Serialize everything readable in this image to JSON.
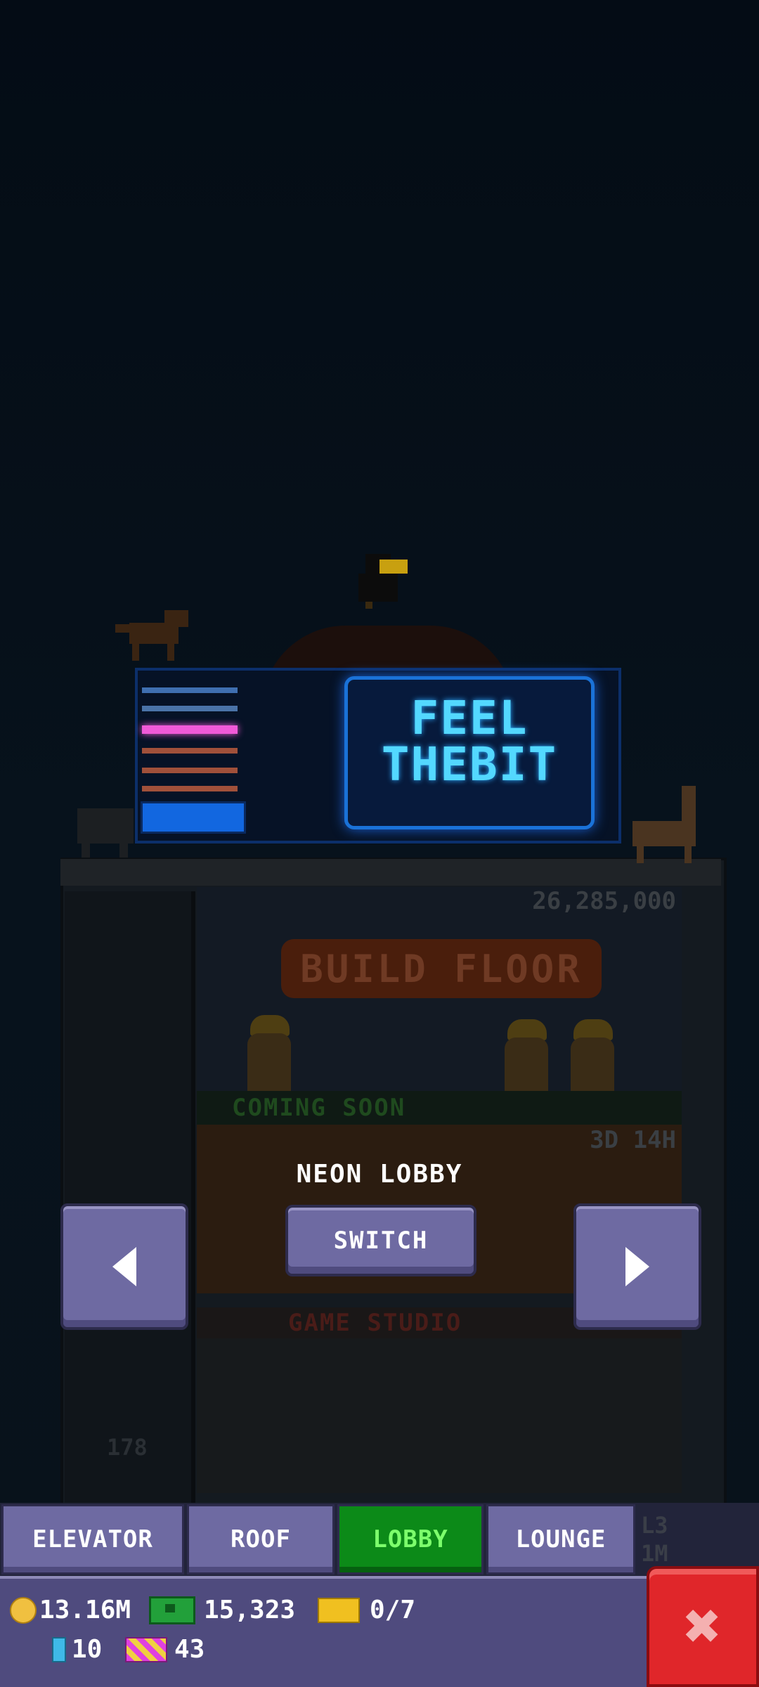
{
  "tower": {
    "build_sign": "BUILD FLOOR",
    "build_price": "26,285,000",
    "coming_soon": "COMING SOON",
    "timer": "3D 14H",
    "studio": "GAME STUDIO",
    "elevator_floor_number": "178"
  },
  "billboard": {
    "line1": "FEEL",
    "line2": "THEBIT"
  },
  "lobby": {
    "title": "NEON LOBBY",
    "switch_label": "SWITCH"
  },
  "tabs": [
    {
      "label": "ELEVATOR",
      "active": false
    },
    {
      "label": "ROOF",
      "active": false
    },
    {
      "label": "LOBBY",
      "active": true
    },
    {
      "label": "LOUNGE",
      "active": false
    }
  ],
  "tab_side_label": {
    "line1": "L3",
    "line2": "1M"
  },
  "stats": {
    "coins": "13.16M",
    "bux": "15,323",
    "tickets": "0/7",
    "bitizens": "10",
    "vip": "43"
  },
  "colors": {
    "active_tab": "#0c8a18",
    "button": "#6e6aa2",
    "close": "#e0262a"
  },
  "icons": {
    "coin": "coin-icon",
    "cash": "cash-icon",
    "ticket": "ticket-icon",
    "bitizen": "bitizen-icon",
    "vip": "vip-icon",
    "close": "close-icon",
    "prev": "arrow-left-icon",
    "next": "arrow-right-icon"
  }
}
